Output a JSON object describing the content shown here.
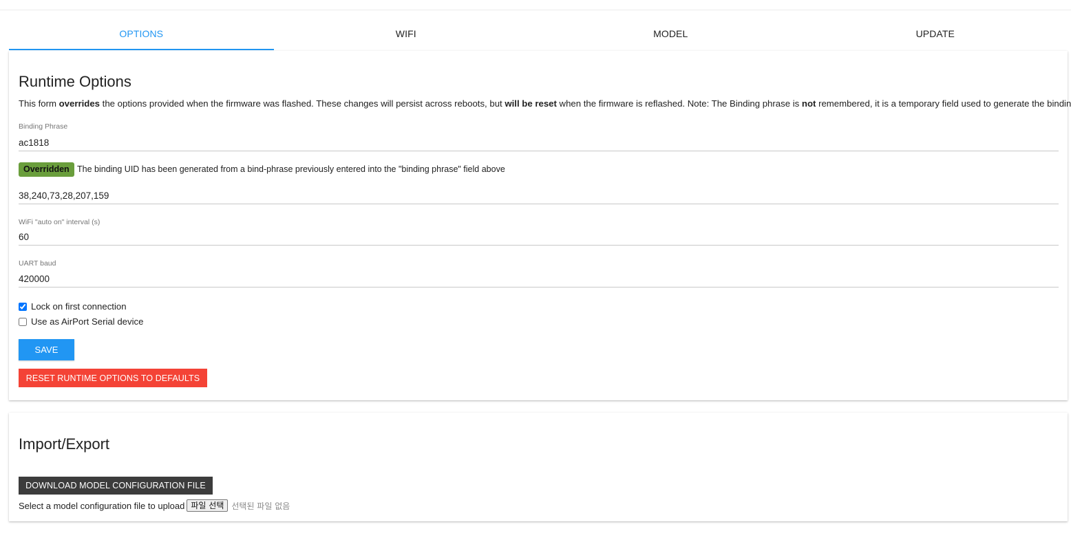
{
  "tabs": [
    {
      "label": "OPTIONS",
      "active": true
    },
    {
      "label": "WIFI",
      "active": false
    },
    {
      "label": "MODEL",
      "active": false
    },
    {
      "label": "UPDATE",
      "active": false
    }
  ],
  "runtime": {
    "title": "Runtime Options",
    "desc_1": "This form ",
    "desc_b1": "overrides",
    "desc_2": " the options provided when the firmware was flashed. These changes will persist across reboots, but ",
    "desc_b2": "will be reset",
    "desc_3": " when the firmware is reflashed. Note: The Binding phrase is ",
    "desc_b3": "not",
    "desc_4": " remembered, it is a temporary field used to generate the binding UID.",
    "binding_phrase_label": "Binding Phrase",
    "binding_phrase_value": "ac1818",
    "badge": "Overridden",
    "badge_text": "The binding UID has been generated from a bind-phrase previously entered into the \"binding phrase\" field above",
    "uid_value": "38,240,73,28,207,159",
    "wifi_interval_label": "WiFi \"auto on\" interval (s)",
    "wifi_interval_value": "60",
    "uart_baud_label": "UART baud",
    "uart_baud_value": "420000",
    "lock_label": "Lock on first connection",
    "lock_checked": true,
    "airport_label": "Use as AirPort Serial device",
    "airport_checked": false,
    "save_label": "SAVE",
    "reset_label": "RESET RUNTIME OPTIONS TO DEFAULTS"
  },
  "import_export": {
    "title": "Import/Export",
    "download_label": "DOWNLOAD MODEL CONFIGURATION FILE",
    "upload_label": "Select a model configuration file to upload",
    "file_button": "파일 선택",
    "file_status": "선택된 파일 없음"
  },
  "colors": {
    "accent": "#2196f3",
    "danger": "#f44336",
    "badge": "#6a9e3c",
    "dark_button": "#3c3c3c"
  }
}
